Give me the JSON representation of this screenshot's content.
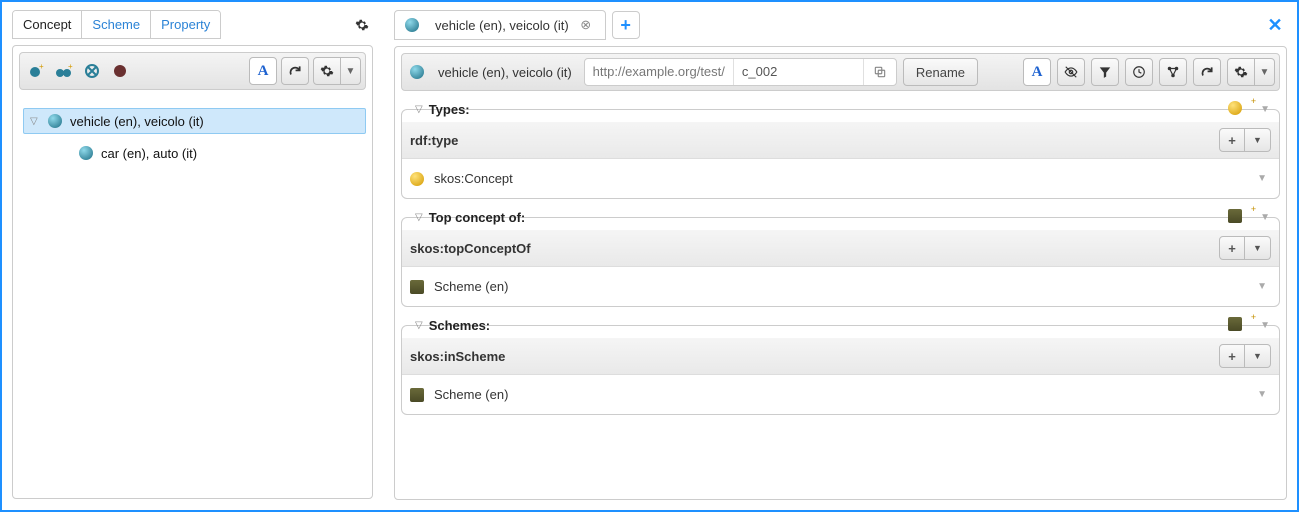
{
  "left": {
    "tabs": {
      "concept": "Concept",
      "scheme": "Scheme",
      "property": "Property",
      "active": "Concept"
    },
    "toolbar": {
      "a_label": "A"
    },
    "tree": [
      {
        "label": "vehicle (en), veicolo (it)",
        "selected": true,
        "children": [
          {
            "label": "car (en), auto (it)"
          }
        ]
      }
    ]
  },
  "right": {
    "tab_label": "vehicle (en), veicolo (it)",
    "resource_label": "vehicle (en), veicolo (it)",
    "uri_base": "http://example.org/test/",
    "uri_local": "c_002",
    "rename_label": "Rename",
    "toolbar": {
      "a_label": "A"
    },
    "sections": {
      "types": {
        "title": "Types:",
        "property": "rdf:type",
        "values": [
          "skos:Concept"
        ]
      },
      "topConceptOf": {
        "title": "Top concept of:",
        "property": "skos:topConceptOf",
        "values": [
          "Scheme (en)"
        ]
      },
      "schemes": {
        "title": "Schemes:",
        "property": "skos:inScheme",
        "values": [
          "Scheme (en)"
        ]
      }
    }
  }
}
